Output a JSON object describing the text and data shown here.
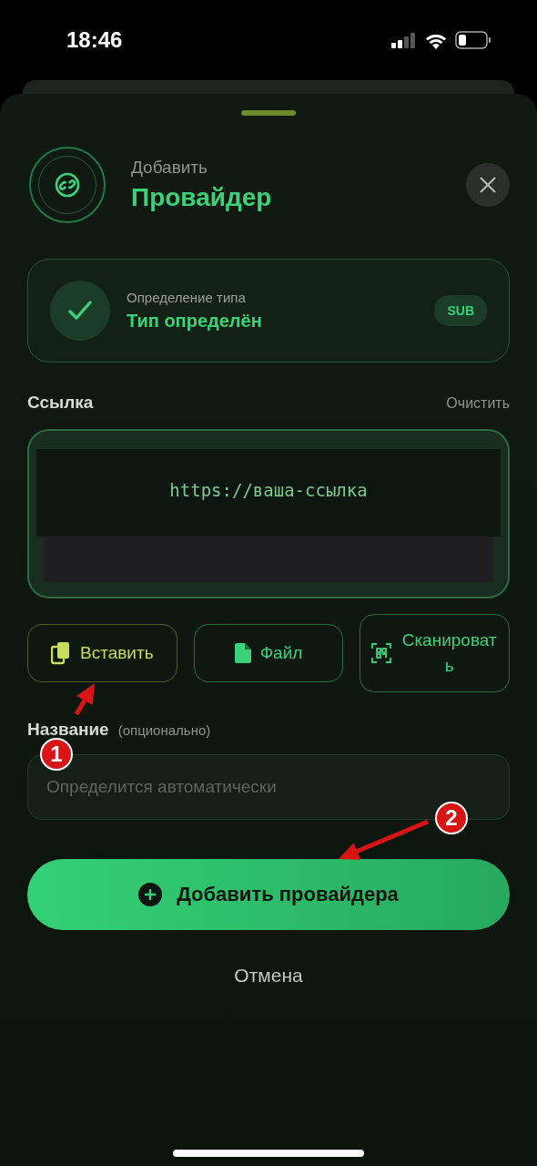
{
  "status_bar": {
    "time": "18:46"
  },
  "header": {
    "subtitle": "Добавить",
    "title": "Провайдер"
  },
  "detection": {
    "label": "Определение типа",
    "status": "Тип определён",
    "badge": "SUB"
  },
  "link": {
    "label": "Ссылка",
    "clear": "Очистить",
    "placeholder": "https://ваша-ссылка"
  },
  "actions": [
    {
      "label": "Вставить",
      "kind": "paste"
    },
    {
      "label": "Файл",
      "kind": "file"
    },
    {
      "label": "Сканировать",
      "kind": "scan"
    }
  ],
  "name": {
    "label": "Название",
    "hint": "(опционально)",
    "placeholder": "Определится автоматически"
  },
  "primary_button": "Добавить провайдера",
  "cancel": "Отмена",
  "annotations": [
    {
      "label": "1"
    },
    {
      "label": "2"
    }
  ]
}
